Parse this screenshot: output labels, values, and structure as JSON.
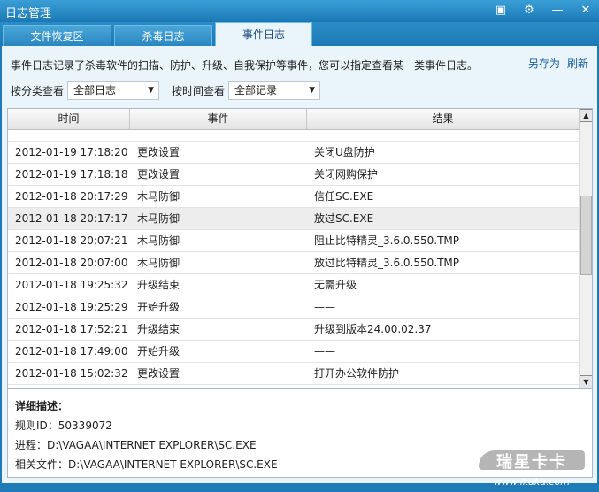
{
  "window": {
    "title": "日志管理"
  },
  "tabs": [
    "文件恢复区",
    "杀毒日志",
    "事件日志"
  ],
  "description": "事件日志记录了杀毒软件的扫描、防护、升级、自我保护等事件，您可以指定查看某一类事件日志。",
  "links": {
    "save_as": "另存为",
    "refresh": "刷新"
  },
  "filters": {
    "category_label": "按分类查看",
    "category_value": "全部日志",
    "time_label": "按时间查看",
    "time_value": "全部记录"
  },
  "table": {
    "columns": [
      "时间",
      "事件",
      "结果"
    ],
    "rows": [
      [
        "2012-01-19 17:18:20",
        "更改设置",
        "关闭U盘防护"
      ],
      [
        "2012-01-19 17:18:18",
        "更改设置",
        "关闭网购保护"
      ],
      [
        "2012-01-18 20:17:29",
        "木马防御",
        "信任SC.EXE"
      ],
      [
        "2012-01-18 20:17:17",
        "木马防御",
        "放过SC.EXE"
      ],
      [
        "2012-01-18 20:07:21",
        "木马防御",
        "阻止比特精灵_3.6.0.550.TMP"
      ],
      [
        "2012-01-18 20:07:00",
        "木马防御",
        "放过比特精灵_3.6.0.550.TMP"
      ],
      [
        "2012-01-18 19:25:32",
        "升级结束",
        "无需升级"
      ],
      [
        "2012-01-18 19:25:29",
        "开始升级",
        "——"
      ],
      [
        "2012-01-18 17:52:21",
        "升级结束",
        "升级到版本24.00.02.37"
      ],
      [
        "2012-01-18 17:49:00",
        "开始升级",
        "——"
      ],
      [
        "2012-01-18 15:02:32",
        "更改设置",
        "打开办公软件防护"
      ]
    ]
  },
  "detail": {
    "title": "详细描述：",
    "rule_id": "规则ID：50339072",
    "process": "进程：D:\\VAGAA\\INTERNET EXPLORER\\SC.EXE",
    "file": "相关文件：D:\\VAGAA\\INTERNET EXPLORER\\SC.EXE"
  },
  "watermark": {
    "name": "瑞星卡卡",
    "url": "www.ikaka.com"
  }
}
